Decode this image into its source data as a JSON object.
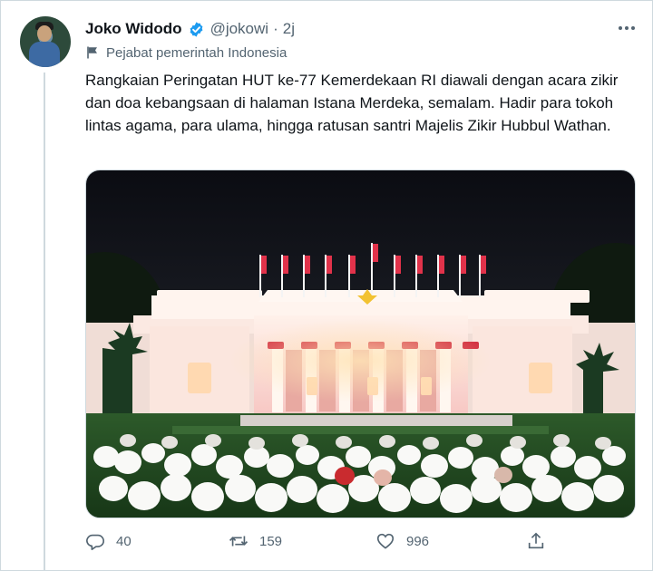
{
  "tweet": {
    "author_name": "Joko Widodo",
    "handle": "@jokowi",
    "separator": "·",
    "time": "2j",
    "verified": true,
    "label": "Pejabat pemerintah Indonesia",
    "text": "Rangkaian Peringatan HUT ke-77 Kemerdekaan RI diawali dengan acara zikir dan doa kebangsaan di halaman Istana Merdeka, semalam. Hadir para tokoh lintas agama, para ulama, hingga ratusan santri Majelis Zikir Hubbul Wathan."
  },
  "actions": {
    "replies": "40",
    "retweets": "159",
    "likes": "996"
  },
  "colors": {
    "verified": "#1d9bf0",
    "muted": "#536471",
    "text": "#0f1419",
    "border": "#cfd9de"
  },
  "icons": [
    "more-icon",
    "verified-badge-icon",
    "flag-icon",
    "reply-icon",
    "retweet-icon",
    "like-icon",
    "share-icon"
  ]
}
